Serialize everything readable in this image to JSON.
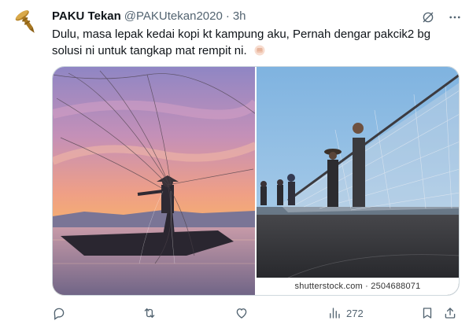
{
  "author": {
    "display_name": "PAKU Tekan",
    "handle": "@PAKUtekan2020",
    "separator": "·",
    "time": "3h"
  },
  "tweet": {
    "text": "Dulu, masa lepak kedai kopi kt kampung aku, Pernah dengar pakcik2 bg solusi ni untuk tangkap mat rempit ni.",
    "emoji": "punch-emoji"
  },
  "media": {
    "images": [
      {
        "icon": "fisherman-sunset-net-photo"
      },
      {
        "icon": "fishermen-hauling-net-photo",
        "watermark": "shutterstock.com · 2504688071"
      }
    ]
  },
  "actions": {
    "views_count": "272"
  },
  "icons": {
    "avatar": "nail-logo-icon",
    "grok": "grok-icon",
    "more": "more-icon",
    "reply": "reply-icon",
    "retweet": "retweet-icon",
    "like": "heart-icon",
    "views": "views-icon",
    "bookmark": "bookmark-icon",
    "share": "share-icon"
  },
  "colors": {
    "text": "#0f1419",
    "secondary": "#536471",
    "border": "#cfd9de"
  }
}
